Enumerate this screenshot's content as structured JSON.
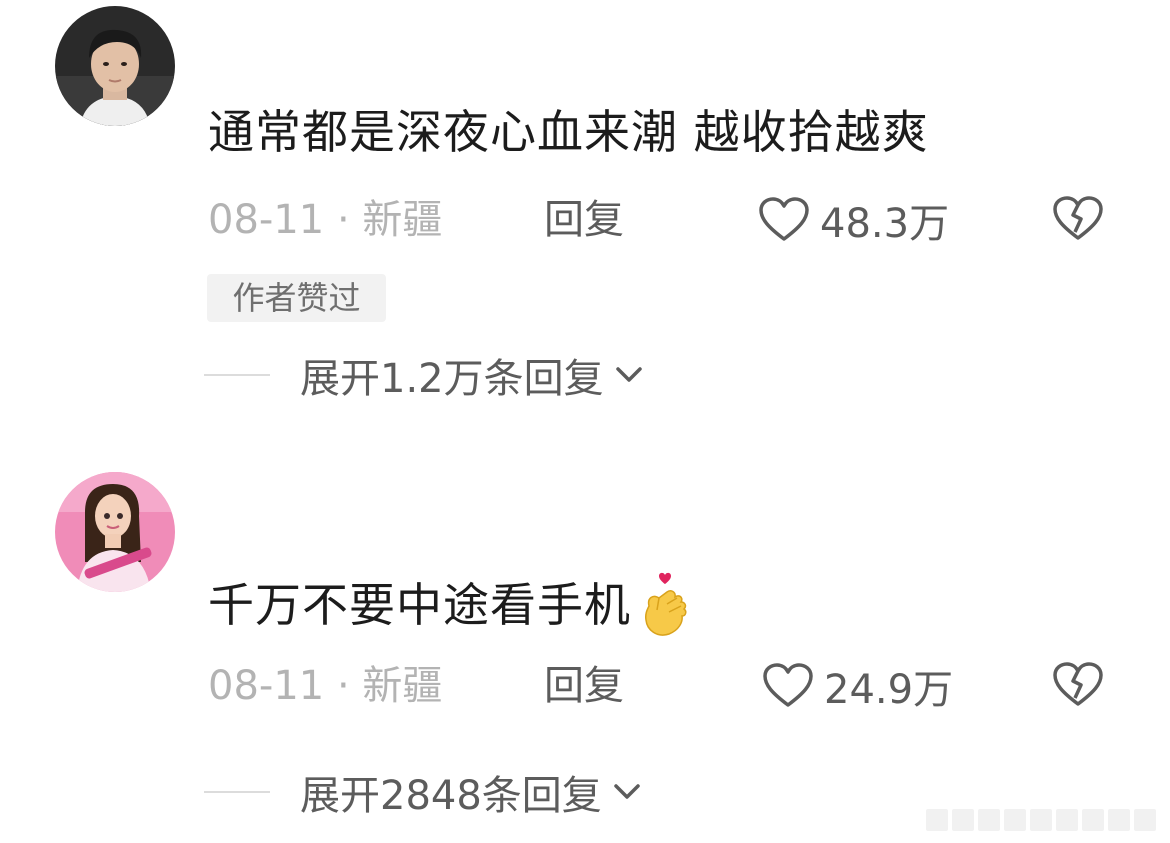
{
  "comments": [
    {
      "avatar": "avatar-young-man",
      "text": "通常都是深夜心血来潮 越收拾越爽",
      "meta": "08-11 · 新疆",
      "reply_label": "回复",
      "likes": "48.3万",
      "badge": "作者赞过",
      "expand_label": "展开1.2万条回复"
    },
    {
      "avatar": "avatar-cartoon-doll",
      "text": "千万不要中途看手机",
      "emoji": "finger-heart-emoji",
      "meta": "08-11 · 新疆",
      "reply_label": "回复",
      "likes": "24.9万",
      "expand_label": "展开2848条回复"
    }
  ],
  "colors": {
    "text": "#1c1c1c",
    "meta": "#b3b3b3",
    "action": "#5c5c5c",
    "badge_bg": "#f2f2f2"
  }
}
